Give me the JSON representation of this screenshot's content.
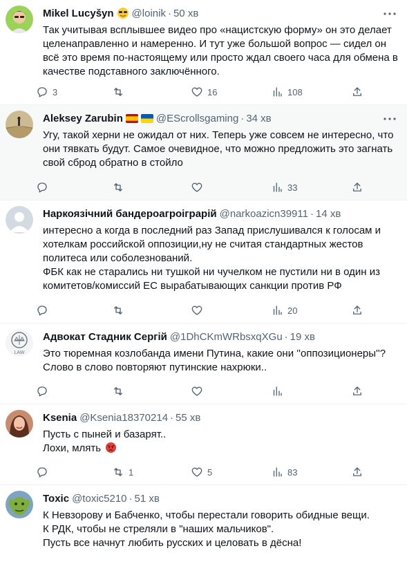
{
  "tweets": [
    {
      "name": "Mikel Lucyšyn",
      "handle": "@loinik",
      "time": "50 хв",
      "badges": [
        "sunglasses-emoji"
      ],
      "text_lines": [
        "Так учитывая всплывшее видео про «нацистскую форму» он это делает",
        "целенаправленно и намеренно. И тут уже большой вопрос — сидел он",
        "всё это время по-настоящему или просто ждал своего часа для обмена в",
        "качестве подставного заключённого."
      ],
      "replies": "3",
      "retweets": "",
      "likes": "16",
      "views": "108",
      "highlighted": false
    },
    {
      "name": "Aleksey Zarubin",
      "handle": "@EScrollsgaming",
      "time": "34 хв",
      "badges": [
        "spain-flag",
        "ukraine-flag"
      ],
      "text_lines": [
        "Угу, такой херни не ожидал от них. Теперь уже совсем не интересно, что",
        "они тявкать будут. Самое очевидное, что можно предложить это загнать",
        "свой сброд обратно в стойло"
      ],
      "replies": "",
      "retweets": "",
      "likes": "",
      "views": "33",
      "highlighted": true
    },
    {
      "name": "Наркоязічний бандероагроіграрій",
      "handle": "@narkoazicn39911",
      "time": "14 хв",
      "badges": [],
      "text_lines": [
        "интересно а когда в последний раз Запад прислушивался к голосам и",
        "хотелкам российской оппозиции,ну не считая стандартных жестов",
        "политеса или соболезнований.",
        "ФБК как не старались ни тушкой ни чучелком не пустили ни в один из",
        "комитетов/комиссий ЕС вырабатывающих санкции против РФ"
      ],
      "replies": "",
      "retweets": "",
      "likes": "",
      "views": "20",
      "highlighted": false
    },
    {
      "name": "Адвокат Стадник Сергій",
      "handle": "@1DhCKmWRbsxqXGu",
      "time": "19 хв",
      "badges": [],
      "avatar_text": "LAW",
      "text_lines": [
        "Это тюремная козлобанда имени Путина, какие они ''оппозиционеры''?",
        "Слово в слово повторяют путинские нахрюки.."
      ],
      "replies": "",
      "retweets": "",
      "likes": "",
      "views": "",
      "highlighted": false
    },
    {
      "name": "Ksenia",
      "handle": "@Ksenia18370214",
      "time": "55 хв",
      "badges": [],
      "text_lines": [
        "Пусть с пыней и базарят..",
        "Лохи, млять"
      ],
      "line_emoji": "angry-face-emoji",
      "replies": "",
      "retweets": "1",
      "likes": "5",
      "views": "83",
      "highlighted": false
    },
    {
      "name": "Toxic",
      "handle": "@toxic5210",
      "time": "51 хв",
      "badges": [],
      "text_lines": [
        "К Невзорову и Бабченко, чтобы перестали говорить обидные вещи.",
        "К РДК, чтобы не стреляли в \"наших мальчиков\".",
        "Пусть все начнут любить русских и целовать в дёсна!"
      ],
      "replies": "",
      "retweets": "",
      "likes": "",
      "views": "",
      "highlighted": false
    }
  ],
  "colors": {
    "text": "#0f1419",
    "secondary": "#536471",
    "divider": "#eff3f4",
    "highlight_bg": "#f7f9f9"
  }
}
